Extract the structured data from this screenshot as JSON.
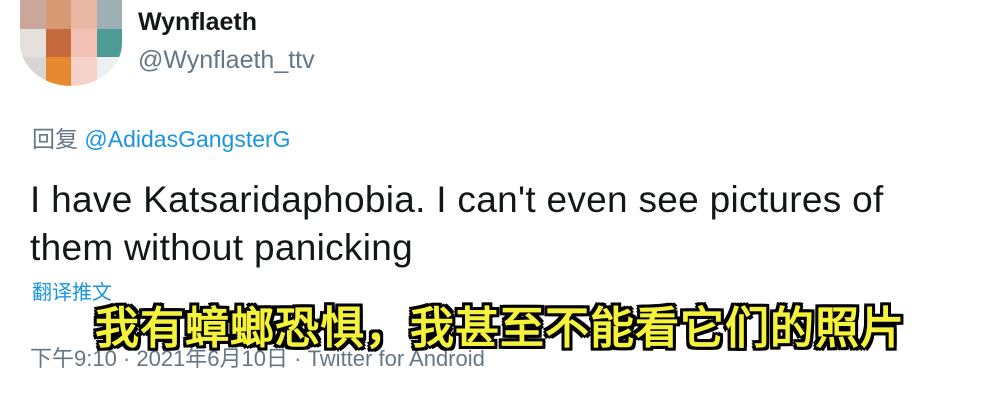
{
  "tweet": {
    "display_name": "Wynflaeth",
    "handle": "@Wynflaeth_ttv",
    "reply_prefix": "回复",
    "reply_to": "@AdidasGangsterG",
    "text": "I have Katsaridaphobia. I can't even see pictures of them without panicking",
    "translate_label": "翻译推文",
    "meta": "下午9:10 · 2021年6月10日 · Twitter for Android"
  },
  "avatar_colors": [
    "#c9a79b",
    "#d89a72",
    "#e9b7a3",
    "#9fb0b5",
    "#e5e0dc",
    "#c56a3e",
    "#f3c2b5",
    "#4e9a96",
    "#d8d5d2",
    "#e7892e",
    "#f4d2c9",
    "#eef0f0"
  ],
  "subtitle": "我有蟑螂恐惧，我甚至不能看它们的照片"
}
